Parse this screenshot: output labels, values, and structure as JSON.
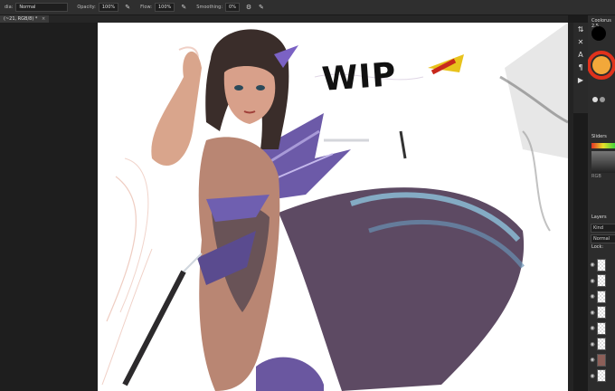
{
  "options": {
    "mode_label": "dia:",
    "mode_value": "Normal",
    "opacity_label": "Opacity:",
    "opacity_value": "100%",
    "flow_label": "Flow:",
    "flow_value": "100%",
    "smoothing_label": "Smoothing:",
    "smoothing_value": "0%"
  },
  "document": {
    "tab_title": "(~21, RGB/8) *",
    "close_glyph": "×"
  },
  "artwork": {
    "wip_text": "WIP"
  },
  "panels": {
    "color_title": "Coolorus 2.5",
    "sliders_title": "Sliders",
    "mode_label": "RGB",
    "layers_title": "Layers",
    "kind_placeholder": "Kind",
    "blend_mode": "Normal",
    "lock_label": "Lock:"
  },
  "icons": {
    "brush_pressure": "pen-pressure-icon",
    "airbrush": "airbrush-icon",
    "gear": "gear-icon",
    "symmetry": "butterfly-icon"
  }
}
